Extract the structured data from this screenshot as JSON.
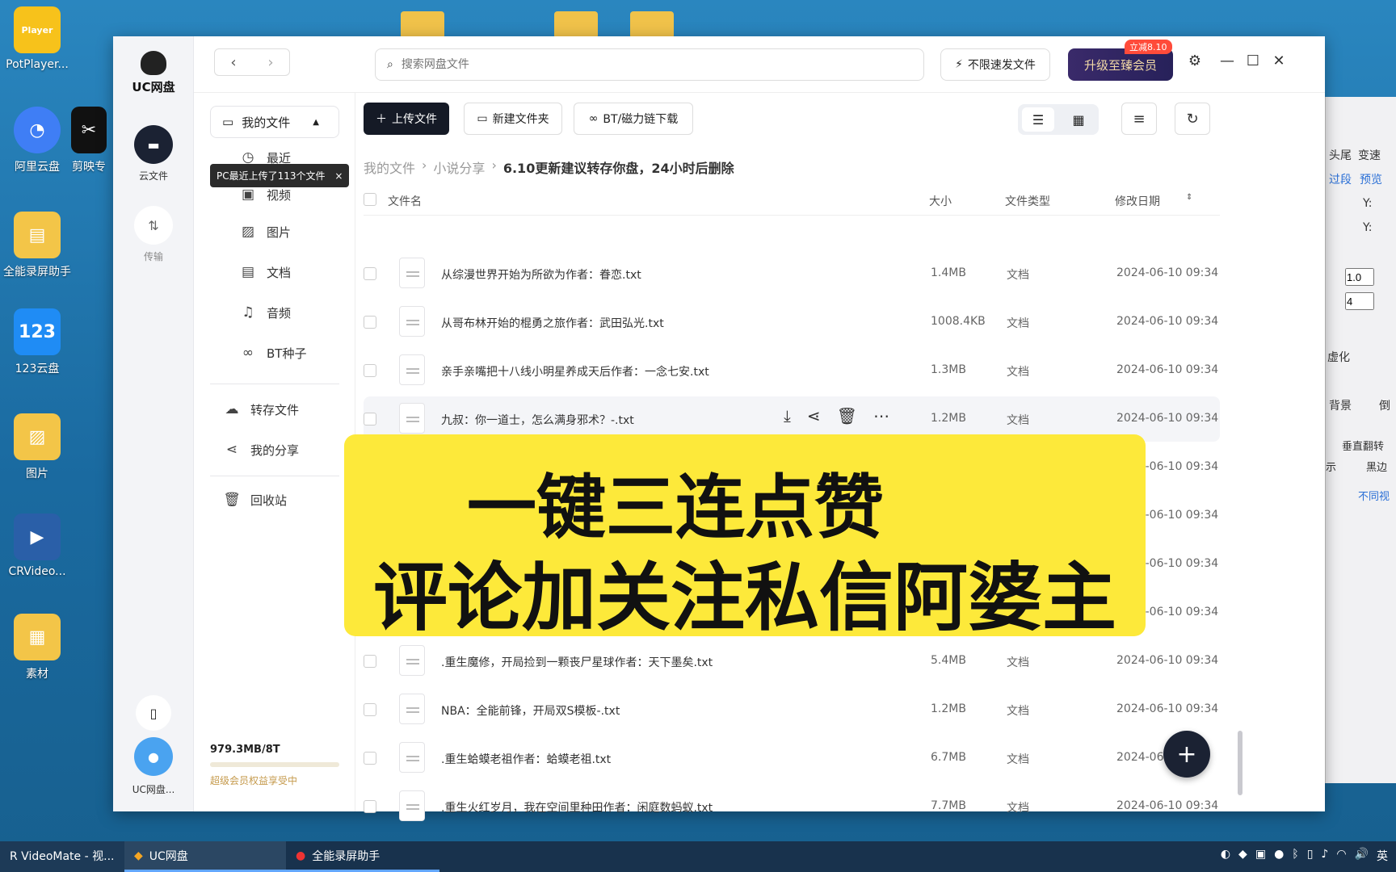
{
  "desktop": {
    "icons": [
      {
        "label": "PotPlayer...",
        "badge": "Player"
      },
      {
        "label": "阿里云盘"
      },
      {
        "label": "剪映专"
      },
      {
        "label": "全能录屏助手"
      },
      {
        "label": "123云盘",
        "badge": "123"
      },
      {
        "label": "图片"
      },
      {
        "label": "CRVideo..."
      },
      {
        "label": "素材"
      }
    ]
  },
  "app": {
    "logo_text": "UC网盘",
    "left_rail": {
      "cloud_files": "云文件",
      "transfer": "传输",
      "account_label": "UC网盘..."
    },
    "search": {
      "placeholder": "搜索网盘文件"
    },
    "speed_button": "不限速发文件",
    "vip_button": "升级至臻会员",
    "vip_badge": "立减8.10",
    "nav": {
      "my_files": "我的文件",
      "recent": "最近",
      "video": "视频",
      "images": "图片",
      "docs": "文档",
      "audio": "音频",
      "bt": "BT种子",
      "transfer_files": "转存文件",
      "my_share": "我的分享",
      "recycle": "回收站"
    },
    "tooltip": "PC最近上传了113个文件",
    "storage": {
      "used": "979.3MB/8T",
      "vip_note": "超级会员权益享受中",
      "usage_fraction": 0.0001
    },
    "toolbar": {
      "upload": "上传文件",
      "new_folder": "新建文件夹",
      "bt_download": "BT/磁力链下载"
    },
    "breadcrumb": {
      "root": "我的文件",
      "sub": "小说分享",
      "current": "6.10更新建议转存你盘，24小时后删除"
    },
    "columns": {
      "name": "文件名",
      "size": "大小",
      "type": "文件类型",
      "date": "修改日期"
    },
    "files": [
      {
        "name": "从综漫世界开始为所欲为作者：眷恋.txt",
        "size": "1.4MB",
        "type": "文档",
        "date": "2024-06-10 09:34"
      },
      {
        "name": "从哥布林开始的棍勇之旅作者：武田弘光.txt",
        "size": "1008.4KB",
        "type": "文档",
        "date": "2024-06-10 09:34"
      },
      {
        "name": "亲手亲嘴把十八线小明星养成天后作者：一念七安.txt",
        "size": "1.3MB",
        "type": "文档",
        "date": "2024-06-10 09:34"
      },
      {
        "name": "九叔：你一道士，怎么满身邪术？-.txt",
        "size": "1.2MB",
        "type": "文档",
        "date": "2024-06-10 09:34"
      },
      {
        "name": "",
        "size": "",
        "type": "",
        "date": "2024-06-10 09:34"
      },
      {
        "name": "",
        "size": "",
        "type": "",
        "date": "2024-06-10 09:34"
      },
      {
        "name": "",
        "size": "",
        "type": "",
        "date": "2024-06-10 09:34"
      },
      {
        "name": "",
        "size": "",
        "type": "",
        "date": "2024-06-10 09:34"
      },
      {
        "name": ".重生魔修，开局捡到一颗丧尸星球作者：天下墨矣.txt",
        "size": "5.4MB",
        "type": "文档",
        "date": "2024-06-10 09:34"
      },
      {
        "name": "NBA：全能前锋，开局双S模板-.txt",
        "size": "1.2MB",
        "type": "文档",
        "date": "2024-06-10 09:34"
      },
      {
        "name": ".重生蛤蟆老祖作者：蛤蟆老祖.txt",
        "size": "6.7MB",
        "type": "文档",
        "date": "2024-06-"
      },
      {
        "name": ".重生火红岁月，我在空间里种田作者：闲庭数蚂蚁.txt",
        "size": "7.7MB",
        "type": "文档",
        "date": "2024-06-10 09:34"
      }
    ]
  },
  "banner": {
    "line1": "一键三连点赞",
    "line2": "评论加关注私信阿婆主"
  },
  "right_window": {
    "tabs": [
      "头尾",
      "变速"
    ],
    "links": [
      "过段",
      "预览"
    ],
    "fields": [
      "Y:",
      "Y:"
    ],
    "values": [
      "1.0",
      "4"
    ],
    "labels": [
      "虚化",
      "背景",
      "倒",
      "垂直翻转",
      "示",
      "黑边",
      "不同视"
    ]
  },
  "taskbar": {
    "items": [
      "R VideoMate - 视...",
      "UC网盘",
      "全能录屏助手"
    ],
    "lang": "英"
  }
}
